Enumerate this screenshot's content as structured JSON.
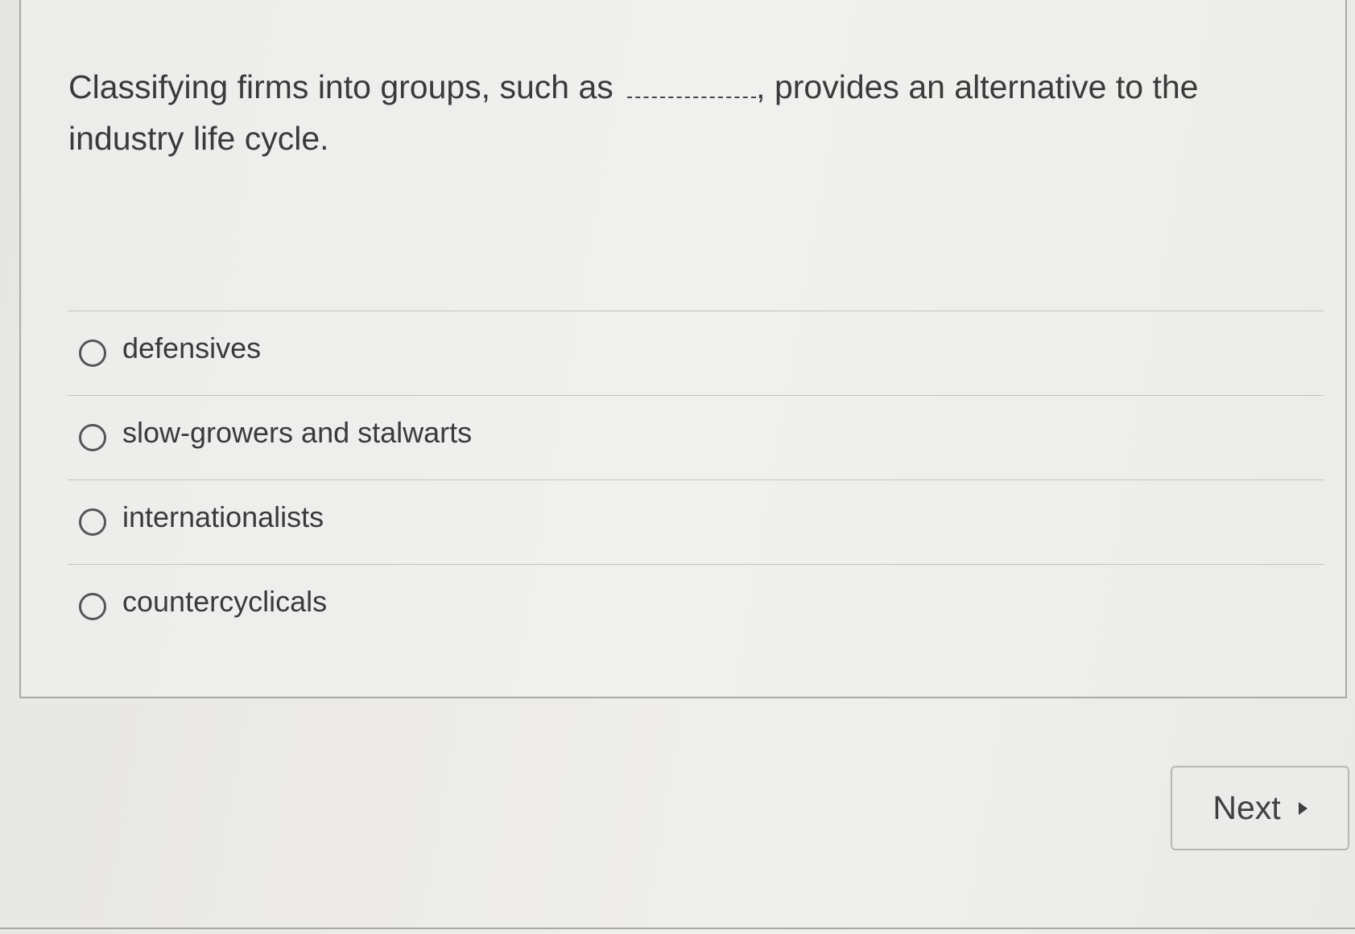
{
  "question": {
    "text_before": "Classifying firms into groups, such as",
    "text_after": ", provides an alternative to the industry life cycle."
  },
  "options": [
    {
      "label": "defensives",
      "selected": false
    },
    {
      "label": "slow-growers and stalwarts",
      "selected": false
    },
    {
      "label": "internationalists",
      "selected": false
    },
    {
      "label": "countercyclicals",
      "selected": false
    }
  ],
  "navigation": {
    "next_label": "Next",
    "next_icon": "play-triangle-icon"
  }
}
